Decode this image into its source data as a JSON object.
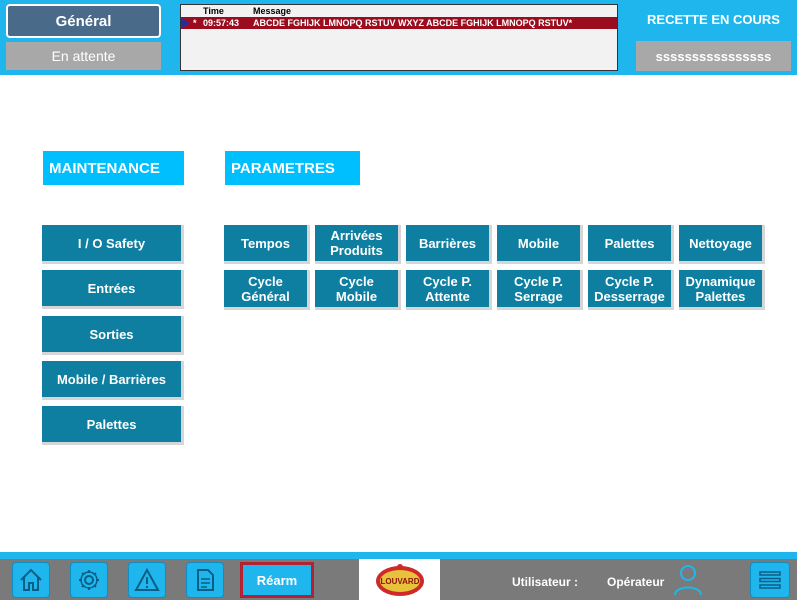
{
  "header": {
    "tab_general": "Général",
    "tab_attente": "En attente",
    "alarm_header_time": "Time",
    "alarm_header_message": "Message",
    "alarm_row": {
      "star": "*",
      "time": "09:57:43",
      "message": "ABCDE FGHIJK LMNOPQ RSTUV WXYZ ABCDE FGHIJK LMNOPQ RSTUV*"
    },
    "status": "RECETTE EN COURS",
    "recipe_field": "ssssssssssssssss"
  },
  "maintenance": {
    "title": "MAINTENANCE",
    "items": [
      {
        "label": "I / O Safety"
      },
      {
        "label": "Entrées"
      },
      {
        "label": "Sorties"
      },
      {
        "label": "Mobile / Barrières"
      },
      {
        "label": "Palettes"
      }
    ]
  },
  "parametres": {
    "title": "PARAMETRES",
    "row1": [
      {
        "label": "Tempos"
      },
      {
        "label": "Arrivées\nProduits"
      },
      {
        "label": "Barrières"
      },
      {
        "label": "Mobile"
      },
      {
        "label": "Palettes"
      },
      {
        "label": "Nettoyage"
      }
    ],
    "row2": [
      {
        "label": "Cycle\nGénéral"
      },
      {
        "label": "Cycle\nMobile"
      },
      {
        "label": "Cycle P.\nAttente"
      },
      {
        "label": "Cycle P.\nSerrage"
      },
      {
        "label": "Cycle P.\nDesserrage"
      },
      {
        "label": "Dynamique\nPalettes"
      }
    ]
  },
  "footer": {
    "icons": [
      "home-icon",
      "gear-icon",
      "warning-icon",
      "document-icon"
    ],
    "rearm_label": "Réarm",
    "logo_text": "LOUVARD",
    "user_label": "Utilisateur :",
    "user_name": "Opérateur",
    "menu_icon": "hamburger-menu-icon"
  },
  "colors": {
    "accent": "#1fb6ee",
    "button": "#0e7fa0",
    "section": "#00bfff",
    "alarm": "#9b0d1e",
    "rearm_border": "#b22234"
  }
}
